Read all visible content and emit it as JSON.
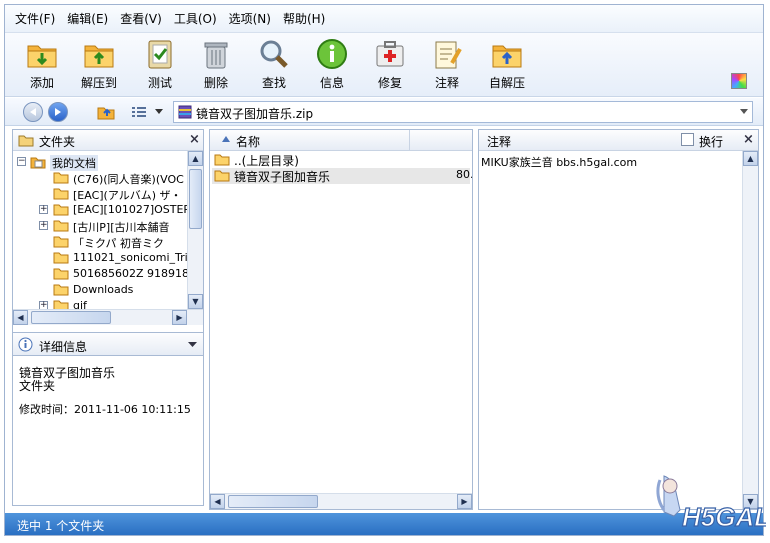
{
  "menu": [
    "文件(F)",
    "编辑(E)",
    "查看(V)",
    "工具(O)",
    "选项(N)",
    "帮助(H)"
  ],
  "toolbar": {
    "add": "添加",
    "extract": "解压到",
    "test": "测试",
    "delete": "删除",
    "find": "查找",
    "info": "信息",
    "repair": "修复",
    "comment": "注释",
    "sfx": "自解压"
  },
  "address": {
    "path": "镜音双子图加音乐.zip"
  },
  "folder_pane": {
    "title": "文件夹",
    "root": "我的文档",
    "items": [
      "(C76)(同人音楽)(VOC",
      "[EAC](アルバム) ザ・",
      "[EAC][101027]OSTER",
      "[古川P][古川本舗音",
      "「ミクパ  初音ミク",
      "111021_sonicomi_Tri",
      "501685602Z 918918",
      "Downloads",
      "gif"
    ]
  },
  "details": {
    "title": "详细信息",
    "name": "镜音双子图加音乐",
    "type": "文件夹",
    "modified": "修改时间：2011-11-06 10:11:15"
  },
  "file_list": {
    "col_name": "名称",
    "rows": [
      {
        "name": "..(上层目录)",
        "size": ""
      },
      {
        "name": "镜音双子图加音乐",
        "size": "80."
      }
    ]
  },
  "comment_pane": {
    "title": "注释",
    "wrap": "换行",
    "text": "MIKU家族兰音 bbs.h5gal.com"
  },
  "status": {
    "text": "选中 1 个文件夹"
  },
  "watermark": "H5GAL"
}
